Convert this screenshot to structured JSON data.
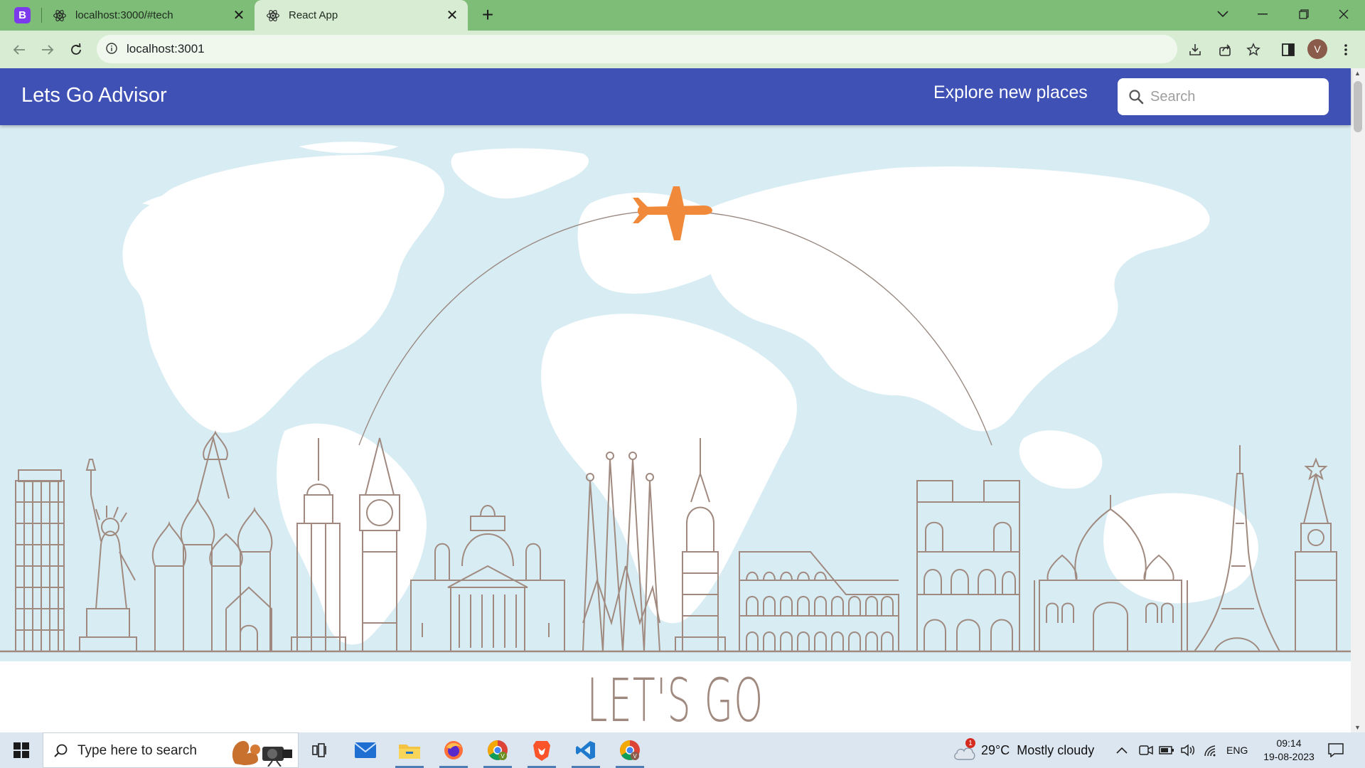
{
  "browser": {
    "pinned_tab_letter": "B",
    "tabs": [
      {
        "title": "localhost:3000/#tech",
        "active": false
      },
      {
        "title": "React App",
        "active": true
      }
    ],
    "url": "localhost:3001",
    "profile_initial": "V"
  },
  "app": {
    "brand": "Lets Go Advisor",
    "tagline": "Explore new places",
    "search_placeholder": "Search",
    "hero_heading": "LET'S GO"
  },
  "colors": {
    "appbar": "#3f51b5",
    "hero_sky": "#d8ecf3",
    "landmark_stroke": "#a08a80",
    "plane": "#f08a3a"
  },
  "taskbar": {
    "search_placeholder": "Type here to search",
    "apps": [
      "task-view-icon",
      "mail-icon",
      "file-explorer-icon",
      "firefox-icon",
      "chrome-icon",
      "brave-icon",
      "vscode-icon",
      "chrome-icon"
    ],
    "weather_badge": "1",
    "weather": "29°C  Mostly cloudy",
    "language": "ENG",
    "time": "09:14",
    "date": "19-08-2023"
  }
}
